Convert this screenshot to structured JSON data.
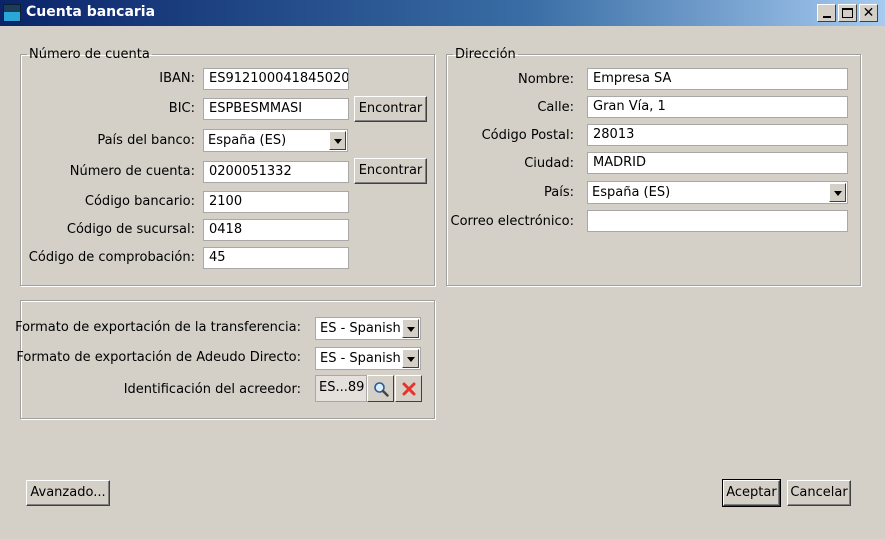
{
  "window": {
    "title": "Cuenta bancaria",
    "minimize_icon": "minimize-icon",
    "maximize_icon": "maximize-icon",
    "close_icon": "close-icon",
    "close_glyph": "✕"
  },
  "account": {
    "legend": "Número de cuenta",
    "iban_label": "IBAN:",
    "iban_value": "ES912100041845020",
    "bic_label": "BIC:",
    "bic_value": "ESPBESMMASI",
    "find_button": "Encontrar",
    "bank_country_label": "País del banco:",
    "bank_country_value": "España (ES)",
    "account_number_label": "Número de cuenta:",
    "account_number_value": "0200051332",
    "bank_code_label": "Código bancario:",
    "bank_code_value": "2100",
    "branch_code_label": "Código de sucursal:",
    "branch_code_value": "0418",
    "check_code_label": "Código de comprobación:",
    "check_code_value": "45"
  },
  "address": {
    "legend": "Dirección",
    "name_label": "Nombre:",
    "name_value": "Empresa SA",
    "street_label": "Calle:",
    "street_value": "Gran Vía, 1",
    "postal_label": "Código Postal:",
    "postal_value": "28013",
    "city_label": "Ciudad:",
    "city_value": "MADRID",
    "country_label": "País:",
    "country_value": "España (ES)",
    "email_label": "Correo electrónico:",
    "email_value": ""
  },
  "export": {
    "transfer_label": "Formato de exportación de la transferencia:",
    "transfer_value": "ES - Spanish",
    "direct_debit_label": "Formato de exportación de Adeudo Directo:",
    "direct_debit_value": "ES - Spanish",
    "creditor_label": "Identificación del acreedor:",
    "creditor_value": "ES...89",
    "search_icon": "magnifier-icon",
    "clear_icon": "red-x-icon"
  },
  "footer": {
    "advanced_button": "Avanzado...",
    "accept_button": "Aceptar",
    "cancel_button": "Cancelar"
  },
  "colors": {
    "titlebar_start": "#0a246a",
    "titlebar_end": "#a6caf0",
    "clear_red": "#e8322a"
  }
}
